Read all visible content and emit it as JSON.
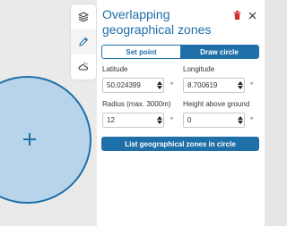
{
  "panel": {
    "title": "Overlapping geographical zones"
  },
  "tabs": {
    "set_point": "Set point",
    "draw_circle": "Draw circle",
    "active": "draw_circle"
  },
  "fields": {
    "latitude": {
      "label": "Latitude",
      "value": "50.024399",
      "unit": "°"
    },
    "longitude": {
      "label": "Longitude",
      "value": "8.700619",
      "unit": "°"
    },
    "radius": {
      "label": "Radius (max. 3000m)",
      "value": "12",
      "unit": "°"
    },
    "height": {
      "label": "Height above ground",
      "value": "0",
      "unit": "°"
    }
  },
  "actions": {
    "list_zones": "List geographical zones in circle"
  },
  "toolstrip": {
    "icons": [
      "layers-icon",
      "pencil-icon",
      "weather-icon"
    ]
  },
  "colors": {
    "accent": "#1f6fa8",
    "circle_fill": "#b8d4ea",
    "trash": "#d32f2f"
  }
}
